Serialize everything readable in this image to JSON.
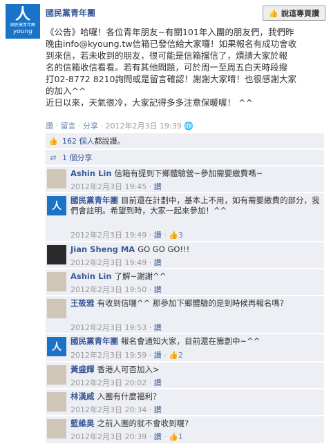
{
  "page": {
    "name": "國民黨青年團",
    "like_button": "說這專頁讚",
    "logo_sub": "國民黨青年團",
    "logo_word": "young"
  },
  "post": {
    "lines": [
      "《公告》哈囉！各位青年朋友~有關101年入團的朋友們，我們昨",
      "晚由info@kyoung.tw信箱已發信給大家囉！如果報名有成功會收",
      "到來信，若未收到的朋友，很可能是信箱擋信了，煩請大家於報",
      "名的信箱收信看看。若有其他問題，可於周一至周五白天時段撥",
      "打02-8772 8210詢問或是留言確認！謝謝大家唷！也很感謝大家",
      "的加入^^",
      "近日以來，天氣很冷，大家記得多多注意保暖喔！ ^^"
    ]
  },
  "post_meta": {
    "like": "讚",
    "comment": "留言",
    "share": "分享",
    "time": "2012年2月3日 19:39"
  },
  "likes_bar": {
    "count": "162 個人",
    "text": "都說讚。"
  },
  "shares_bar": {
    "text": "1 個分享"
  },
  "comments": [
    {
      "author": "Ashin Lin",
      "text": "信箱有提到下鄉體驗營~參加需要繳費嗎~",
      "time": "2012年2月3日 19:45",
      "like": "讚",
      "likes": ""
    },
    {
      "author": "國民黨青年團",
      "text": "目前還在計劃中，基本上不用，如有需要繳費的部分，我們會註明。希望到時，大家一起來參加！^^",
      "time": "2012年2月3日 19:49",
      "like": "讚",
      "likes": "3"
    },
    {
      "author": "Jian Sheng MA",
      "text": "GO GO GO!!!",
      "time": "2012年2月3日 19:49",
      "like": "讚",
      "likes": ""
    },
    {
      "author": "Ashin Lin",
      "text": "了解~謝謝^^",
      "time": "2012年2月3日 19:50",
      "like": "讚",
      "likes": ""
    },
    {
      "author": "王筱雅",
      "text": "有收到信囉^^ 那參加下鄉體驗的是到時候再報名嗎?",
      "time": "2012年2月3日 19:53",
      "like": "讚",
      "likes": ""
    },
    {
      "author": "國民黨青年團",
      "text": "報名會通知大家，目前還在籌劃中~^^",
      "time": "2012年2月3日 19:59",
      "like": "讚",
      "likes": "2"
    },
    {
      "author": "黃盛輝",
      "text": "香港人可否加入>",
      "time": "2012年2月3日 20:02",
      "like": "讚",
      "likes": ""
    },
    {
      "author": "林漢威",
      "text": "入團有什麼福利？",
      "time": "2012年2月3日 20:34",
      "like": "讚",
      "likes": ""
    },
    {
      "author": "藍維昊",
      "text": "之前入團的就不會收到囉?",
      "time": "2012年2月3日 20:39",
      "like": "讚",
      "likes": "1"
    }
  ]
}
